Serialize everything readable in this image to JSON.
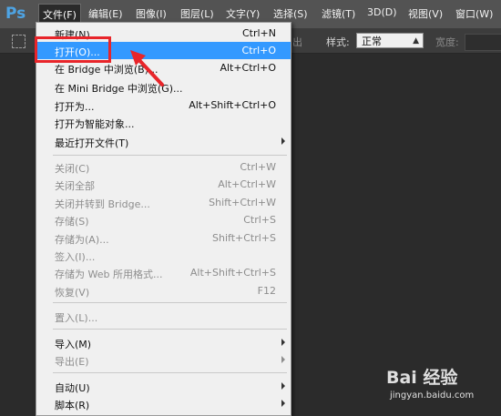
{
  "app": {
    "logo": "Ps"
  },
  "menubar": {
    "items": [
      "文件(F)",
      "编辑(E)",
      "图像(I)",
      "图层(L)",
      "文字(Y)",
      "选择(S)",
      "滤镜(T)",
      "3D(D)",
      "视图(V)",
      "窗口(W)"
    ]
  },
  "options_bar": {
    "partial_text": "出",
    "style_label": "样式:",
    "style_value": "正常",
    "width_label": "宽度:"
  },
  "file_menu": {
    "items": [
      {
        "label": "新建(N)...",
        "shortcut": "Ctrl+N"
      },
      {
        "label": "打开(O)...",
        "shortcut": "Ctrl+O"
      },
      {
        "label": "在 Bridge 中浏览(B)...",
        "shortcut": "Alt+Ctrl+O"
      },
      {
        "label": "在 Mini Bridge 中浏览(G)..."
      },
      {
        "label": "打开为...",
        "shortcut": "Alt+Shift+Ctrl+O"
      },
      {
        "label": "打开为智能对象..."
      },
      {
        "label": "最近打开文件(T)"
      },
      {
        "label": "关闭(C)",
        "shortcut": "Ctrl+W"
      },
      {
        "label": "关闭全部",
        "shortcut": "Alt+Ctrl+W"
      },
      {
        "label": "关闭并转到 Bridge...",
        "shortcut": "Shift+Ctrl+W"
      },
      {
        "label": "存储(S)",
        "shortcut": "Ctrl+S"
      },
      {
        "label": "存储为(A)...",
        "shortcut": "Shift+Ctrl+S"
      },
      {
        "label": "签入(I)..."
      },
      {
        "label": "存储为 Web 所用格式...",
        "shortcut": "Alt+Shift+Ctrl+S"
      },
      {
        "label": "恢复(V)",
        "shortcut": "F12"
      },
      {
        "label": "置入(L)..."
      },
      {
        "label": "导入(M)"
      },
      {
        "label": "导出(E)"
      },
      {
        "label": "自动(U)"
      },
      {
        "label": "脚本(R)"
      }
    ]
  },
  "watermark": {
    "main": "Bai 经验",
    "sub": "jingyan.baidu.com"
  },
  "colors": {
    "highlight": "#3399ff",
    "annotation": "#e8252a",
    "menubar": "#535353",
    "menu_bg": "#f0f0f0"
  }
}
